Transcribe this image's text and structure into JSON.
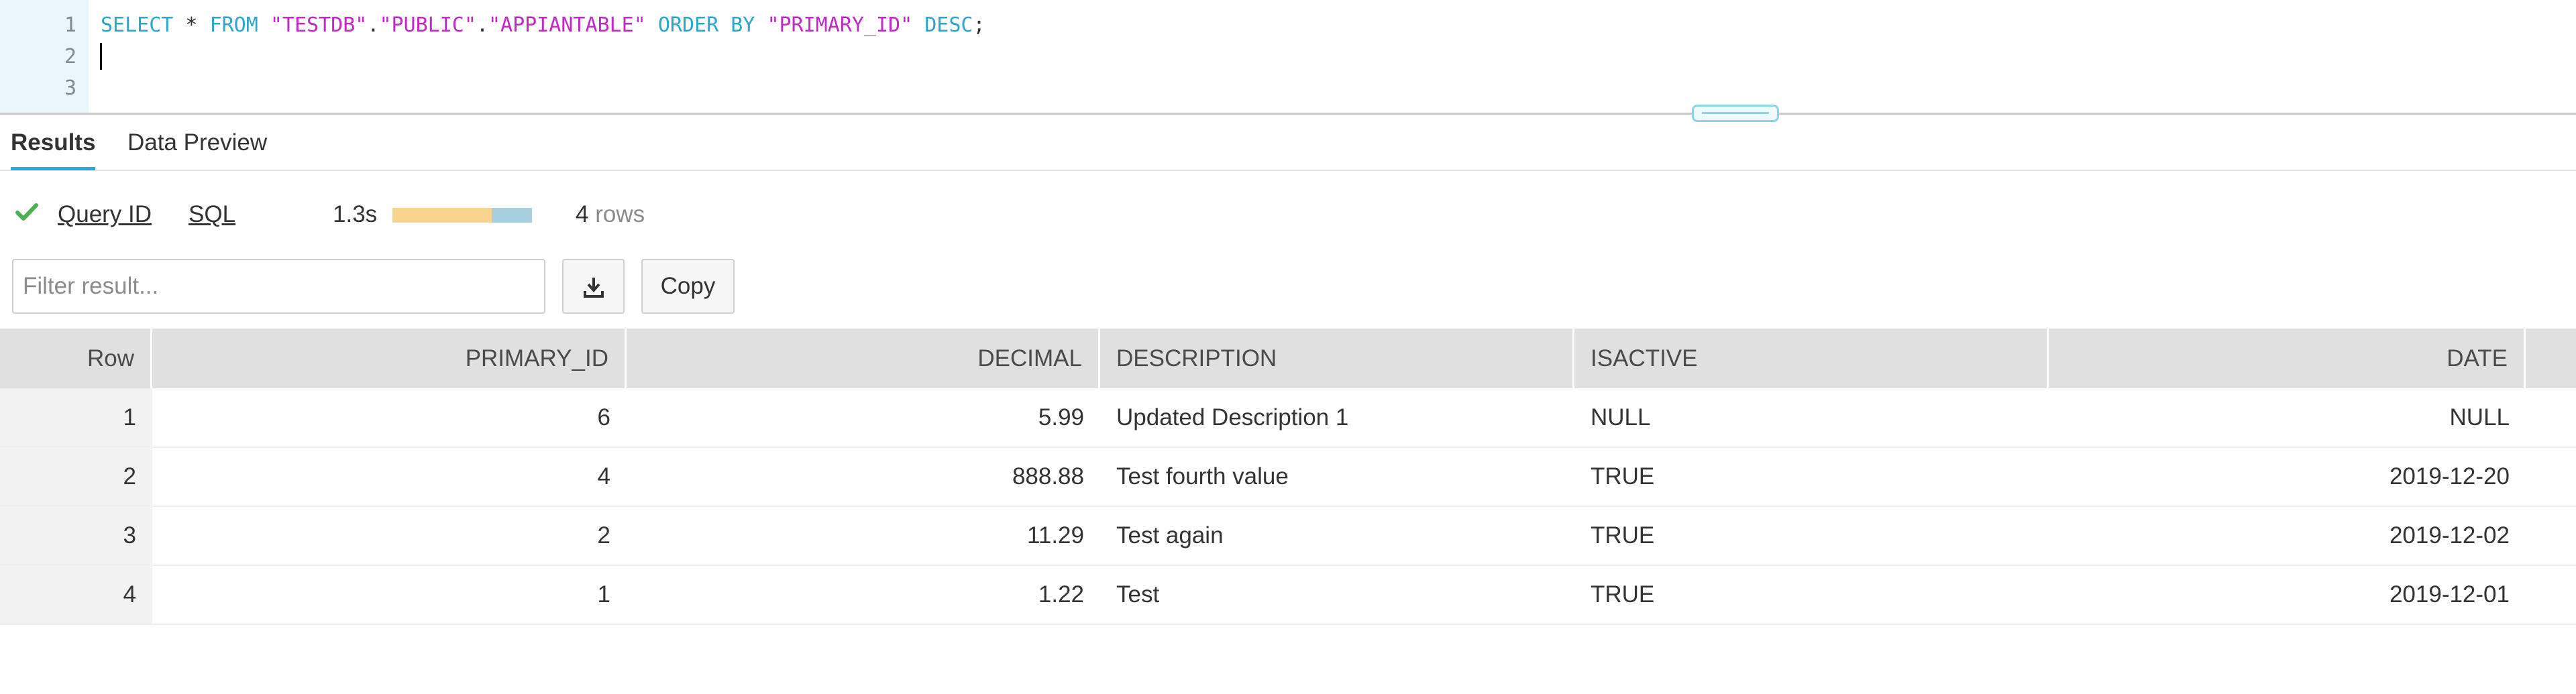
{
  "editor": {
    "line_numbers": [
      "1",
      "2",
      "3"
    ],
    "sql_tokens": [
      {
        "text": "SELECT",
        "kind": "kw"
      },
      {
        "text": " * ",
        "kind": "op"
      },
      {
        "text": "FROM",
        "kind": "kw"
      },
      {
        "text": " ",
        "kind": "op"
      },
      {
        "text": "\"TESTDB\"",
        "kind": "str"
      },
      {
        "text": ".",
        "kind": "op"
      },
      {
        "text": "\"PUBLIC\"",
        "kind": "str"
      },
      {
        "text": ".",
        "kind": "op"
      },
      {
        "text": "\"APPIANTABLE\"",
        "kind": "str"
      },
      {
        "text": " ",
        "kind": "op"
      },
      {
        "text": "ORDER BY",
        "kind": "kw"
      },
      {
        "text": " ",
        "kind": "op"
      },
      {
        "text": "\"PRIMARY_ID\"",
        "kind": "str"
      },
      {
        "text": " ",
        "kind": "op"
      },
      {
        "text": "DESC",
        "kind": "kw"
      },
      {
        "text": ";",
        "kind": "op"
      }
    ]
  },
  "tabs": {
    "results": "Results",
    "data_preview": "Data Preview",
    "active": "results"
  },
  "status": {
    "query_id_label": "Query ID",
    "sql_label": "SQL",
    "duration": "1.3s",
    "progress_fraction": 0.29,
    "rows_count": "4",
    "rows_unit": "rows"
  },
  "filter": {
    "placeholder": "Filter result...",
    "value": ""
  },
  "buttons": {
    "copy_label": "Copy",
    "download_icon": "download-icon"
  },
  "table": {
    "columns": [
      "Row",
      "PRIMARY_ID",
      "DECIMAL",
      "DESCRIPTION",
      "ISACTIVE",
      "DATE"
    ],
    "rows": [
      [
        "1",
        "6",
        "5.99",
        "Updated Description 1",
        "NULL",
        "NULL"
      ],
      [
        "2",
        "4",
        "888.88",
        "Test fourth value",
        "TRUE",
        "2019-12-20"
      ],
      [
        "3",
        "2",
        "11.29",
        "Test again",
        "TRUE",
        "2019-12-02"
      ],
      [
        "4",
        "1",
        "1.22",
        "Test",
        "TRUE",
        "2019-12-01"
      ]
    ]
  },
  "colors": {
    "accent": "#29a8d6",
    "keyword": "#2ba6cc",
    "string": "#c228c6",
    "success": "#4caf50",
    "progress_compile": "#f8d48f",
    "progress_execute": "#a6d0dd",
    "header_bg": "#e0e0e0"
  }
}
